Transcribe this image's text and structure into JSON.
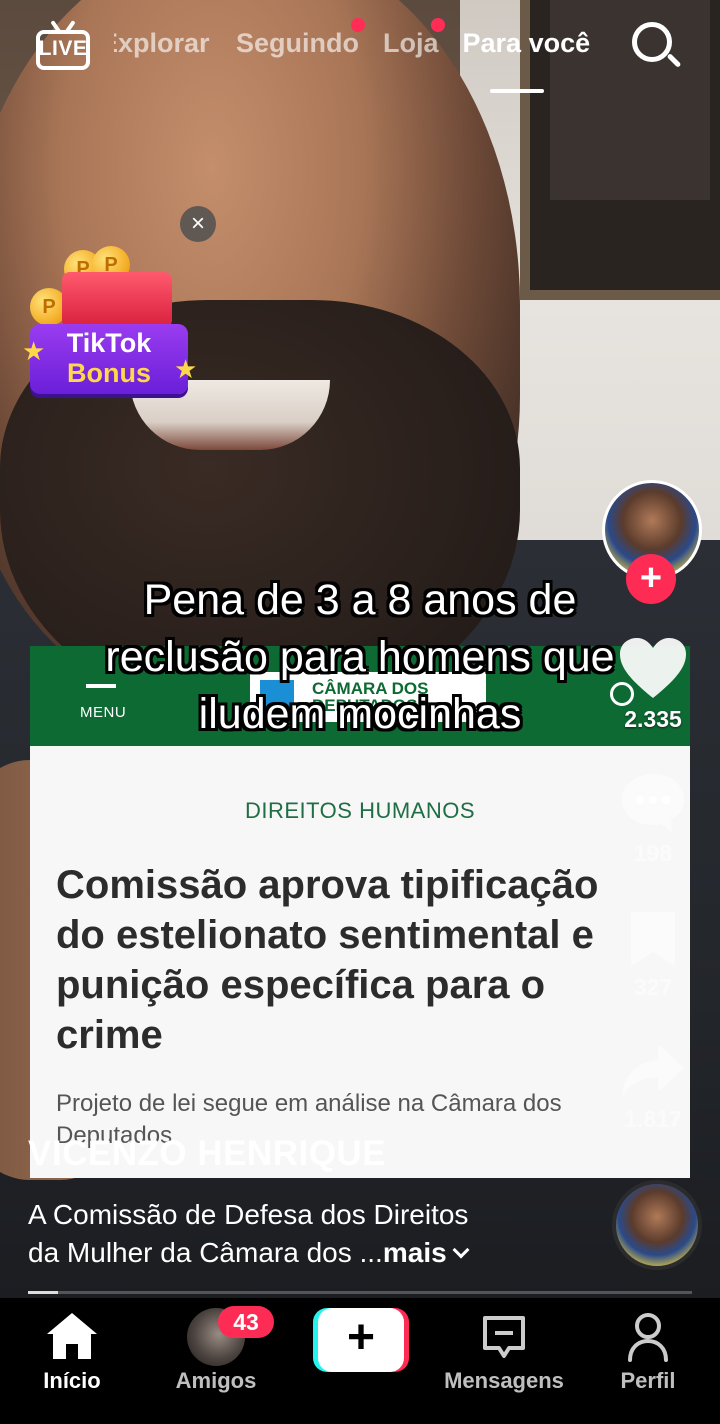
{
  "top_bar": {
    "live_label": "LIVE",
    "tabs": [
      {
        "label": "Explorar",
        "visible_text": "xplorar",
        "dot": false
      },
      {
        "label": "Seguindo",
        "dot": true
      },
      {
        "label": "Loja",
        "dot": true
      },
      {
        "label": "Para você",
        "active": true
      }
    ]
  },
  "bonus_widget": {
    "line1": "TikTok",
    "line2": "Bonus",
    "coin_letter": "P",
    "close_symbol": "×"
  },
  "overlay_caption": {
    "line1": "Pena de 3 a 8 anos de",
    "line2": "reclusão para homens que",
    "line3": "iludem mocinhas"
  },
  "news_card": {
    "menu_label": "MENU",
    "logo_text_1": "CÂMARA DOS",
    "logo_text_2": "DEPUTADOS",
    "section": "DIREITOS HUMANOS",
    "headline": "Comissão aprova tipificação do estelionato sentimental e punição específica para o crime",
    "subheadline": "Projeto de lei segue em análise na Câmara dos Deputados"
  },
  "actions": {
    "like_count": "2.335",
    "comment_count": "198",
    "save_count": "327",
    "share_count": "1.817",
    "follow_symbol": "+"
  },
  "post": {
    "author": "VICENZO HENRIQUE",
    "description_line1": "A Comissão de Defesa dos Direitos",
    "description_line2": "da Mulher da Câmara dos ...",
    "more_label": "mais"
  },
  "bottom_nav": {
    "items": [
      {
        "label": "Início",
        "icon": "home-icon",
        "active": true
      },
      {
        "label": "Amigos",
        "icon": "friends-avatar",
        "badge": "43"
      },
      {
        "label": "",
        "icon": "plus-icon",
        "create": true,
        "symbol": "+"
      },
      {
        "label": "Mensagens",
        "icon": "message-icon"
      },
      {
        "label": "Perfil",
        "icon": "profile-icon"
      }
    ]
  },
  "colors": {
    "accent": "#fe2c55",
    "accent_cyan": "#25f4ee",
    "news_green": "#0d6a33",
    "bonus_purple": "#7a2ee4"
  }
}
